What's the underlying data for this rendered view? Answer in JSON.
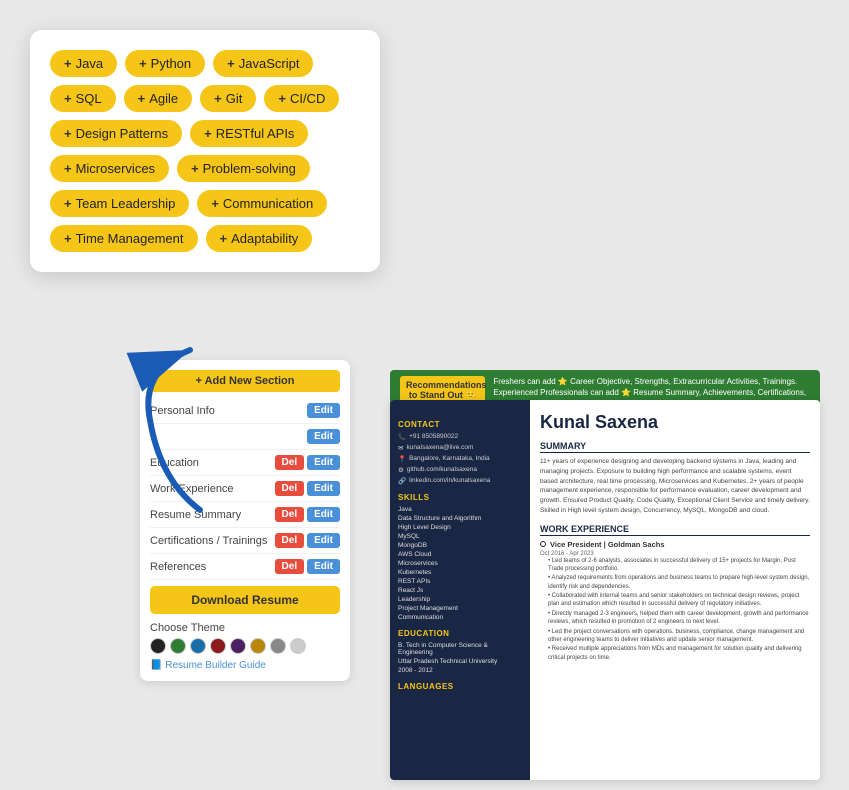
{
  "skills_card": {
    "tags": [
      "Java",
      "Python",
      "JavaScript",
      "SQL",
      "Agile",
      "Git",
      "CI/CD",
      "Design Patterns",
      "RESTful APIs",
      "Microservices",
      "Problem-solving",
      "Team Leadership",
      "Communication",
      "Time Management",
      "Adaptability"
    ]
  },
  "resume_builder": {
    "add_section_label": "+ Add New Section",
    "sections": [
      {
        "name": "Personal Info",
        "has_edit": true,
        "has_del": false
      },
      {
        "name": "",
        "has_edit": true,
        "has_del": false
      },
      {
        "name": "Education",
        "has_edit": true,
        "has_del": true
      },
      {
        "name": "Work Experience",
        "has_edit": true,
        "has_del": true
      },
      {
        "name": "Resume Summary",
        "has_edit": true,
        "has_del": true
      },
      {
        "name": "Certifications / Trainings",
        "has_edit": true,
        "has_del": true
      },
      {
        "name": "References",
        "has_edit": true,
        "has_del": true
      }
    ],
    "download_label": "Download Resume",
    "theme_label": "Choose Theme",
    "theme_colors": [
      "#222222",
      "#2e7d32",
      "#1a6ea8",
      "#8b1a1a",
      "#4a2060",
      "#b8860b",
      "#888888",
      "#cccccc"
    ],
    "guide_label": "📘 Resume Builder Guide"
  },
  "recommendation_banner": {
    "left_label": "Recommendations to Stand Out 🙂",
    "right_text": "Freshers can add ⭐ Career Objective, Strengths, Extracurricular Activities, Trainings. Experienced Professionals can add ⭐ Resume Summary, Achievements, Certifications, Projects"
  },
  "resume_preview": {
    "name": "Kunal Saxena",
    "contact": {
      "phone": "+91 8505890022",
      "email": "kunalsaxena@live.com",
      "location": "Bangalore, Karnataka, India",
      "github": "github.com/kunalsaxena",
      "linkedin": "linkedin.com/in/kunalsaxena"
    },
    "skills": [
      "Java",
      "Data Structure and Algorithm",
      "High Level Design",
      "MySQL",
      "MongoDB",
      "AWS Cloud",
      "Microservices",
      "Kubernetes",
      "REST APIs",
      "React Js",
      "Leadership",
      "Project Management",
      "Communication"
    ],
    "summary_text": "11+ years of experience designing and developing backend systems in Java, leading and managing projects. Exposure to building high performance and scalable systems, event based architecture, real time processing, Microservices and Kubernetes. 2+ years of people management experience, responsible for performance evaluation, career development and growth. Ensured Product Quality, Code Quality, Exceptional Client Service and timely delivery. Skilled in High level system design, Concurrency, MySQL, MongoDB and cloud.",
    "work_experience": {
      "title": "Vice President | Goldman Sachs",
      "dates": "Oct 2016 - Apr 2023",
      "bullets": [
        "Led teams of 2-6 analysts, associates in successful delivery of 15+ projects for Margin, Post Trade processing portfolio.",
        "Analyzed requirements from operations and business teams to prepare high-level system design, identify risk and dependencies.",
        "Collaborated with internal teams and senior stakeholders on technical design reviews, project plan and estimation which resulted in successful delivery of regulatory initiatives.",
        "Directly managed 2-3 engineers, helped them with career development, growth and performance reviews, which resulted in promotion of 2 engineers to next level.",
        "Led the project conversations with operations, business, compliance, change management and other engineering teams to deliver initiatives and update senior management.",
        "Received multiple appreciations from MDs and management for solution quality and delivering critical projects on time."
      ]
    },
    "education": {
      "degree": "B. Tech in Computer Science & Engineering",
      "school": "Uttar Pradesh Technical University",
      "dates": "2008 - 2012"
    }
  }
}
